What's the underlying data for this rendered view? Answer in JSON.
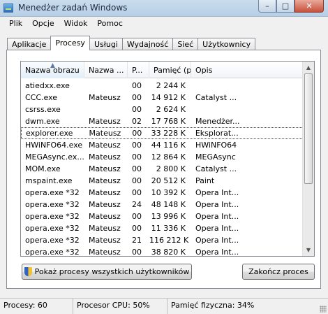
{
  "window": {
    "title": "Menedżer zadań Windows",
    "minimize": "–",
    "maximize": "□",
    "close": "✕"
  },
  "menu": [
    "Plik",
    "Opcje",
    "Widok",
    "Pomoc"
  ],
  "tabs": [
    "Aplikacje",
    "Procesy",
    "Usługi",
    "Wydajność",
    "Sieć",
    "Użytkownicy"
  ],
  "active_tab": "Procesy",
  "columns": [
    "Nazwa obrazu",
    "Nazwa ...",
    "P...",
    "Pamięć (p...",
    "Opis"
  ],
  "processes": [
    {
      "image": "atiedxx.exe",
      "user": "",
      "cpu": "00",
      "memory": "2 244 K",
      "desc": ""
    },
    {
      "image": "CCC.exe",
      "user": "Mateusz",
      "cpu": "00",
      "memory": "14 912 K",
      "desc": "Catalyst ..."
    },
    {
      "image": "csrss.exe",
      "user": "",
      "cpu": "00",
      "memory": "2 624 K",
      "desc": ""
    },
    {
      "image": "dwm.exe",
      "user": "Mateusz",
      "cpu": "02",
      "memory": "17 768 K",
      "desc": "Menedżer..."
    },
    {
      "image": "explorer.exe",
      "user": "Mateusz",
      "cpu": "00",
      "memory": "33 228 K",
      "desc": "Eksplorat...",
      "selected": true
    },
    {
      "image": "HWiNFO64.exe",
      "user": "Mateusz",
      "cpu": "00",
      "memory": "44 116 K",
      "desc": "HWiNFO64"
    },
    {
      "image": "MEGAsync.ex...",
      "user": "Mateusz",
      "cpu": "00",
      "memory": "12 864 K",
      "desc": "MEGAsync"
    },
    {
      "image": "MOM.exe",
      "user": "Mateusz",
      "cpu": "00",
      "memory": "2 800 K",
      "desc": "Catalyst ..."
    },
    {
      "image": "mspaint.exe",
      "user": "Mateusz",
      "cpu": "00",
      "memory": "20 512 K",
      "desc": "Paint"
    },
    {
      "image": "opera.exe *32",
      "user": "Mateusz",
      "cpu": "00",
      "memory": "10 392 K",
      "desc": "Opera Int..."
    },
    {
      "image": "opera.exe *32",
      "user": "Mateusz",
      "cpu": "24",
      "memory": "48 148 K",
      "desc": "Opera Int..."
    },
    {
      "image": "opera.exe *32",
      "user": "Mateusz",
      "cpu": "00",
      "memory": "13 996 K",
      "desc": "Opera Int..."
    },
    {
      "image": "opera.exe *32",
      "user": "Mateusz",
      "cpu": "00",
      "memory": "11 336 K",
      "desc": "Opera Int..."
    },
    {
      "image": "opera.exe *32",
      "user": "Mateusz",
      "cpu": "21",
      "memory": "116 212 K",
      "desc": "Opera Int..."
    },
    {
      "image": "opera.exe *32",
      "user": "Mateusz",
      "cpu": "00",
      "memory": "38 820 K",
      "desc": "Opera Int..."
    }
  ],
  "buttons": {
    "show_all": "Pokaż procesy wszystkich użytkowników",
    "end_process": "Zakończ proces"
  },
  "status": {
    "processes": "Procesy: 60",
    "cpu": "Procesor CPU: 50%",
    "memory": "Pamięć fizyczna: 34%"
  }
}
